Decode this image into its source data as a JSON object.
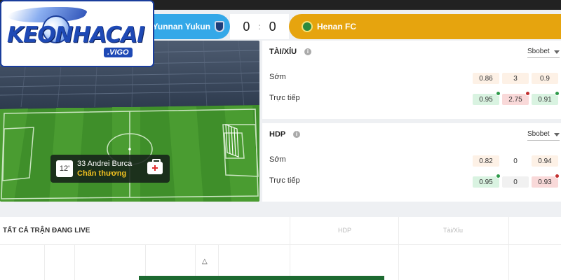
{
  "logo": {
    "text": "KEONHACAI",
    "sub": ".VIGO"
  },
  "match": {
    "home_team": "Yunnan Yukun",
    "away_team": "Henan FC",
    "home_score": "0",
    "away_score": "0",
    "separator": ":"
  },
  "event": {
    "minute": "12'",
    "player": "33 Andrei Burca",
    "type": "Chấn thương"
  },
  "taixiu": {
    "title": "TÀI/XỈU",
    "bookmaker": "Sbobet",
    "rows": [
      {
        "label": "Sớm",
        "values": [
          "0.86",
          "3",
          "0.9"
        ]
      },
      {
        "label": "Trực tiếp",
        "values": [
          "0.95",
          "2.75",
          "0.91"
        ]
      }
    ]
  },
  "hdp": {
    "title": "HDP",
    "bookmaker": "Sbobet",
    "rows": [
      {
        "label": "Sớm",
        "values": [
          "0.82",
          "0",
          "0.94"
        ]
      },
      {
        "label": "Trực tiếp",
        "values": [
          "0.95",
          "0",
          "0.93"
        ]
      }
    ]
  },
  "live_list": {
    "title": "TẤT CẢ TRẬN ĐANG LIVE",
    "columns": [
      "HDP",
      "Tài/Xỉu"
    ]
  },
  "colors": {
    "home": "#34a8e8",
    "away": "#e6a40e",
    "pitch": "#3f8f2a",
    "odds_up": "#2e9a4a",
    "odds_down": "#c23030"
  },
  "icons": [
    "shield-icon",
    "club-crest-icon",
    "info-icon",
    "dropdown-arrow-icon",
    "first-aid-kit-icon",
    "playstation-icon"
  ]
}
